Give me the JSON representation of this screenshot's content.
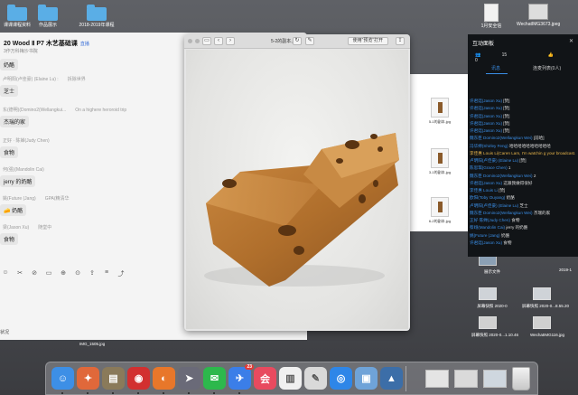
{
  "desktop": {
    "folders": [
      {
        "label": "课课课程资料"
      },
      {
        "label": "作品展示"
      },
      {
        "label": "2018-2019年课程"
      }
    ],
    "top_right_files": [
      {
        "label": "1月安全信"
      },
      {
        "label": "WechatIMG3673.jpeg"
      }
    ],
    "bottom_items": [
      {
        "label": "IMG_1505.jpg"
      },
      {
        "label": "屏幕快照 2020-0...1.10.46"
      },
      {
        "label": "WechatIMG116.jpg"
      },
      {
        "label": "屏幕快照 2020-0...8.55.20"
      },
      {
        "label": "屏幕快照 2020-0"
      },
      {
        "label": "展示文件"
      },
      {
        "label": "2019-1"
      }
    ]
  },
  "left_window": {
    "title": "20 Wood Ⅱ P7 木艺基础课",
    "title_tag": "直播",
    "subtitle": "3作万科梅沙书院",
    "messages": [
      {
        "meta": "",
        "extra": "",
        "text": "奶酪"
      },
      {
        "meta": "卢明阳(卢佳豪)  (Elaine Lu) :",
        "extra": "拆除世界",
        "text": "芝士"
      },
      {
        "meta": "东(德明)(Domino2(Wellangkui...",
        "extra": "On a highere heroroid trip",
        "text": "杰瑞的家"
      },
      {
        "meta": "正好 · 陈婵(Judy Chen)",
        "extra": "",
        "text": "食物"
      },
      {
        "meta": "何(强)(Mandolin Cai)",
        "extra": "",
        "text": "jerry 的奶酪"
      },
      {
        "meta": "姚(Future (Jang)",
        "extra": "GPA(精清华",
        "text": "奶酪"
      },
      {
        "meta": "梁(Jason Xu)",
        "extra": "随堂中",
        "text": "食物"
      }
    ],
    "toolbar": [
      "☺",
      "✂",
      "⊘",
      "▭",
      "⊕",
      "⊙",
      "⇪",
      "≡",
      "⤴"
    ],
    "hint": "↩ 发送 / 换行 发送",
    "send_label": "发送",
    "status": "状况"
  },
  "preview": {
    "filename": "5-2的副本.jpg",
    "open_with": "使用“预览”打开",
    "nav_prev": "‹",
    "nav_next": "›",
    "view_icon": "▭",
    "rotate_icon": "↻",
    "markup_icon": "✎",
    "share_icon": "⇪"
  },
  "finder_strip": {
    "items": [
      {
        "label": "5-1的副本.jpg"
      },
      {
        "label": "3-1的副本.jpg"
      },
      {
        "label": "6-2的副本.jpg"
      }
    ]
  },
  "live_panel": {
    "title": "互动面板",
    "close": "✕",
    "viewers": "15",
    "likes": "0",
    "tabs": [
      "讯息",
      "连麦列表(0人)"
    ],
    "messages": [
      {
        "name": "许君廷(Jason Xu)",
        "text": "[赞]",
        "color": "n"
      },
      {
        "name": "许君廷(Jason Xu)",
        "text": "[赞]",
        "color": "n"
      },
      {
        "name": "许君廷(Jason Xu)",
        "text": "[赞]",
        "color": "n"
      },
      {
        "name": "许君廷(Jason Xu)",
        "text": "[赞]",
        "color": "n"
      },
      {
        "name": "许君廷(Jason Xu)",
        "text": "[赞]",
        "color": "n"
      },
      {
        "name": "魏东臣 Domino2(Wellangkun Wei)",
        "text": "[前哈]",
        "color": "n"
      },
      {
        "name": "冯华婷(Shirley Feng)",
        "text": "哈哈哈哈哈哈哈哈哈哈",
        "color": "n"
      },
      {
        "name": "李佳惠 Louis Li(Caren Lam, I'm watchin",
        "text": "g your broadcast.",
        "color": "y"
      },
      {
        "name": "卢明阳(卢佳豪) (Elaine Lu)",
        "text": "[赞]",
        "color": "n"
      },
      {
        "name": "陈思琪(Grace Chen)",
        "text": "1",
        "color": "n"
      },
      {
        "name": "魏东臣 Domino2(Wellangkun Wei)",
        "text": "2",
        "color": "n"
      },
      {
        "name": "许君廷(Jason Xu)",
        "text": "这跟我做得很好",
        "color": "n"
      },
      {
        "name": "李佳惠 Louis Li",
        "text": "[赞]",
        "color": "n"
      },
      {
        "name": "欧阳(Toby Ouyang)",
        "text": "奶酪",
        "color": "n"
      },
      {
        "name": "卢明阳(卢佳豪) (Elaine Lu)",
        "text": "芝士",
        "color": "n"
      },
      {
        "name": "魏东臣 Domino2(Wellangkun Wei)",
        "text": "杰瑞的家",
        "color": "n"
      },
      {
        "name": "正好·陈婵(Judy Chen)",
        "text": "食物",
        "color": "n"
      },
      {
        "name": "蔡翊(Mandolin Cai)",
        "text": "jerry 的奶酪",
        "color": "n"
      },
      {
        "name": "姚(Future (Jang)",
        "text": "奶酪",
        "color": "n"
      },
      {
        "name": "许君廷(Jason Xu)",
        "text": "食物",
        "color": "n"
      }
    ]
  },
  "dock": {
    "apps": [
      {
        "name": "finder-icon",
        "glyph": "☺",
        "color": "#3d8fe6"
      },
      {
        "name": "launchpad-icon",
        "glyph": "✦",
        "color": "#e0683a"
      },
      {
        "name": "notes-icon",
        "glyph": "▤",
        "color": "#8a7a5a"
      },
      {
        "name": "netease-music-icon",
        "glyph": "◉",
        "color": "#d23030"
      },
      {
        "name": "firefox-icon",
        "glyph": "◐",
        "color": "#e8772a"
      },
      {
        "name": "rocket-icon",
        "glyph": "➤",
        "color": "#6a6a78"
      },
      {
        "name": "wechat-icon",
        "glyph": "✉",
        "color": "#2db84c"
      },
      {
        "name": "feishu-icon",
        "glyph": "✈",
        "color": "#3b7ee8"
      },
      {
        "name": "tencent-meeting-icon",
        "glyph": "会",
        "color": "#e84a5f"
      },
      {
        "name": "charts-icon",
        "glyph": "▥",
        "color": "#f0f0f0"
      },
      {
        "name": "textedit-icon",
        "glyph": "✎",
        "color": "#d9d9d9"
      },
      {
        "name": "safari-icon",
        "glyph": "◎",
        "color": "#2e86e8"
      },
      {
        "name": "preview-icon",
        "glyph": "▣",
        "color": "#6fa3d8"
      },
      {
        "name": "keynote-icon",
        "glyph": "▲",
        "color": "#3c6ea8"
      }
    ],
    "badge": "23",
    "right_items": [
      {
        "name": "downloads-stack-icon"
      },
      {
        "name": "screenshot-stack-icon"
      },
      {
        "name": "desktop-stack-icon"
      },
      {
        "name": "trash-icon"
      }
    ]
  }
}
